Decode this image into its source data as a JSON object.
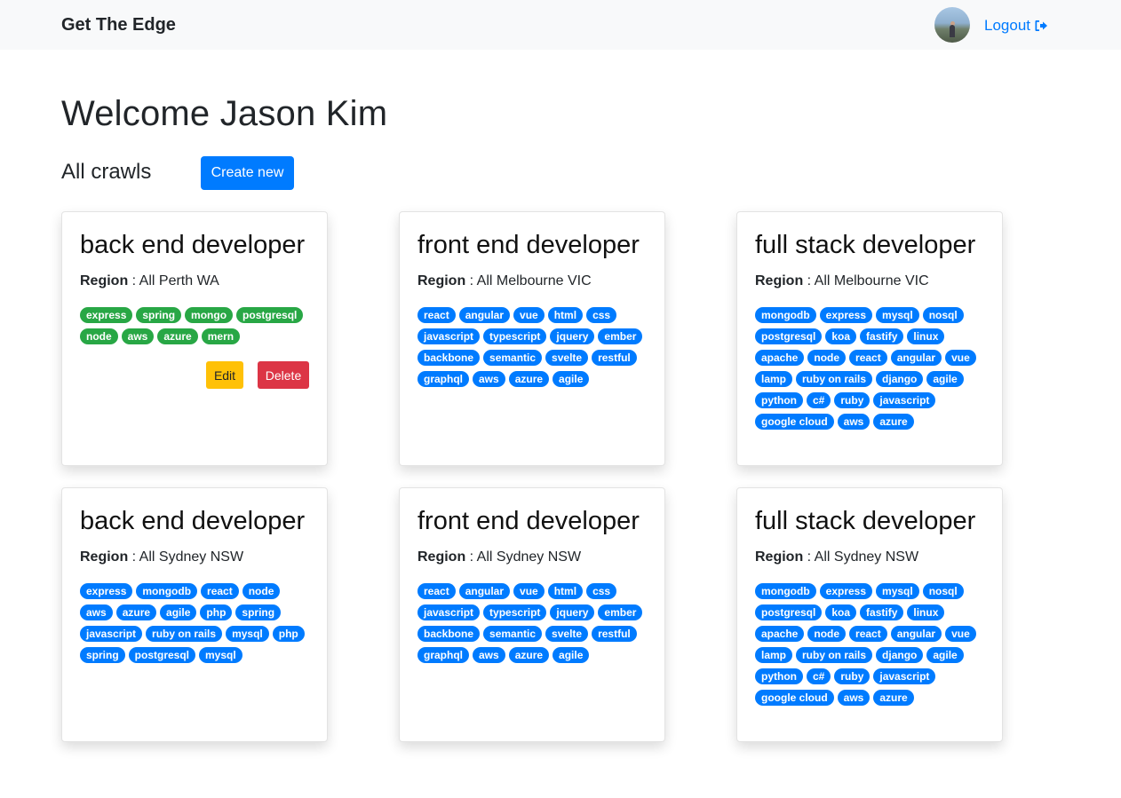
{
  "nav": {
    "brand": "Get The Edge",
    "logout_label": "Logout",
    "logout_icon": "sign-out-icon"
  },
  "main": {
    "welcome": "Welcome Jason Kim",
    "section_title": "All crawls",
    "create_button": "Create new"
  },
  "region_label": "Region",
  "edit_label": "Edit",
  "delete_label": "Delete",
  "colors": {
    "primary": "#007bff",
    "success": "#28a745",
    "warning": "#ffc107",
    "danger": "#dc3545"
  },
  "cards": [
    {
      "title": "back end developer",
      "region": "All Perth WA",
      "tag_color": "green",
      "has_actions": true,
      "tags": [
        "express",
        "spring",
        "mongo",
        "postgresql",
        "node",
        "aws",
        "azure",
        "mern"
      ]
    },
    {
      "title": "front end developer",
      "region": "All Melbourne VIC",
      "tag_color": "blue",
      "has_actions": false,
      "tags": [
        "react",
        "angular",
        "vue",
        "html",
        "css",
        "javascript",
        "typescript",
        "jquery",
        "ember",
        "backbone",
        "semantic",
        "svelte",
        "restful",
        "graphql",
        "aws",
        "azure",
        "agile"
      ]
    },
    {
      "title": "full stack developer",
      "region": "All Melbourne VIC",
      "tag_color": "blue",
      "has_actions": false,
      "tags": [
        "mongodb",
        "express",
        "mysql",
        "nosql",
        "postgresql",
        "koa",
        "fastify",
        "linux",
        "apache",
        "node",
        "react",
        "angular",
        "vue",
        "lamp",
        "ruby on rails",
        "django",
        "agile",
        "python",
        "c#",
        "ruby",
        "javascript",
        "google cloud",
        "aws",
        "azure"
      ]
    },
    {
      "title": "back end developer",
      "region": "All Sydney NSW",
      "tag_color": "blue",
      "has_actions": false,
      "tags": [
        "express",
        "mongodb",
        "react",
        "node",
        "aws",
        "azure",
        "agile",
        "php",
        "spring",
        "javascript",
        "ruby on rails",
        "mysql",
        "php",
        "spring",
        "postgresql",
        "mysql"
      ]
    },
    {
      "title": "front end developer",
      "region": "All Sydney NSW",
      "tag_color": "blue",
      "has_actions": false,
      "tags": [
        "react",
        "angular",
        "vue",
        "html",
        "css",
        "javascript",
        "typescript",
        "jquery",
        "ember",
        "backbone",
        "semantic",
        "svelte",
        "restful",
        "graphql",
        "aws",
        "azure",
        "agile"
      ]
    },
    {
      "title": "full stack developer",
      "region": "All Sydney NSW",
      "tag_color": "blue",
      "has_actions": false,
      "tags": [
        "mongodb",
        "express",
        "mysql",
        "nosql",
        "postgresql",
        "koa",
        "fastify",
        "linux",
        "apache",
        "node",
        "react",
        "angular",
        "vue",
        "lamp",
        "ruby on rails",
        "django",
        "agile",
        "python",
        "c#",
        "ruby",
        "javascript",
        "google cloud",
        "aws",
        "azure"
      ]
    }
  ]
}
